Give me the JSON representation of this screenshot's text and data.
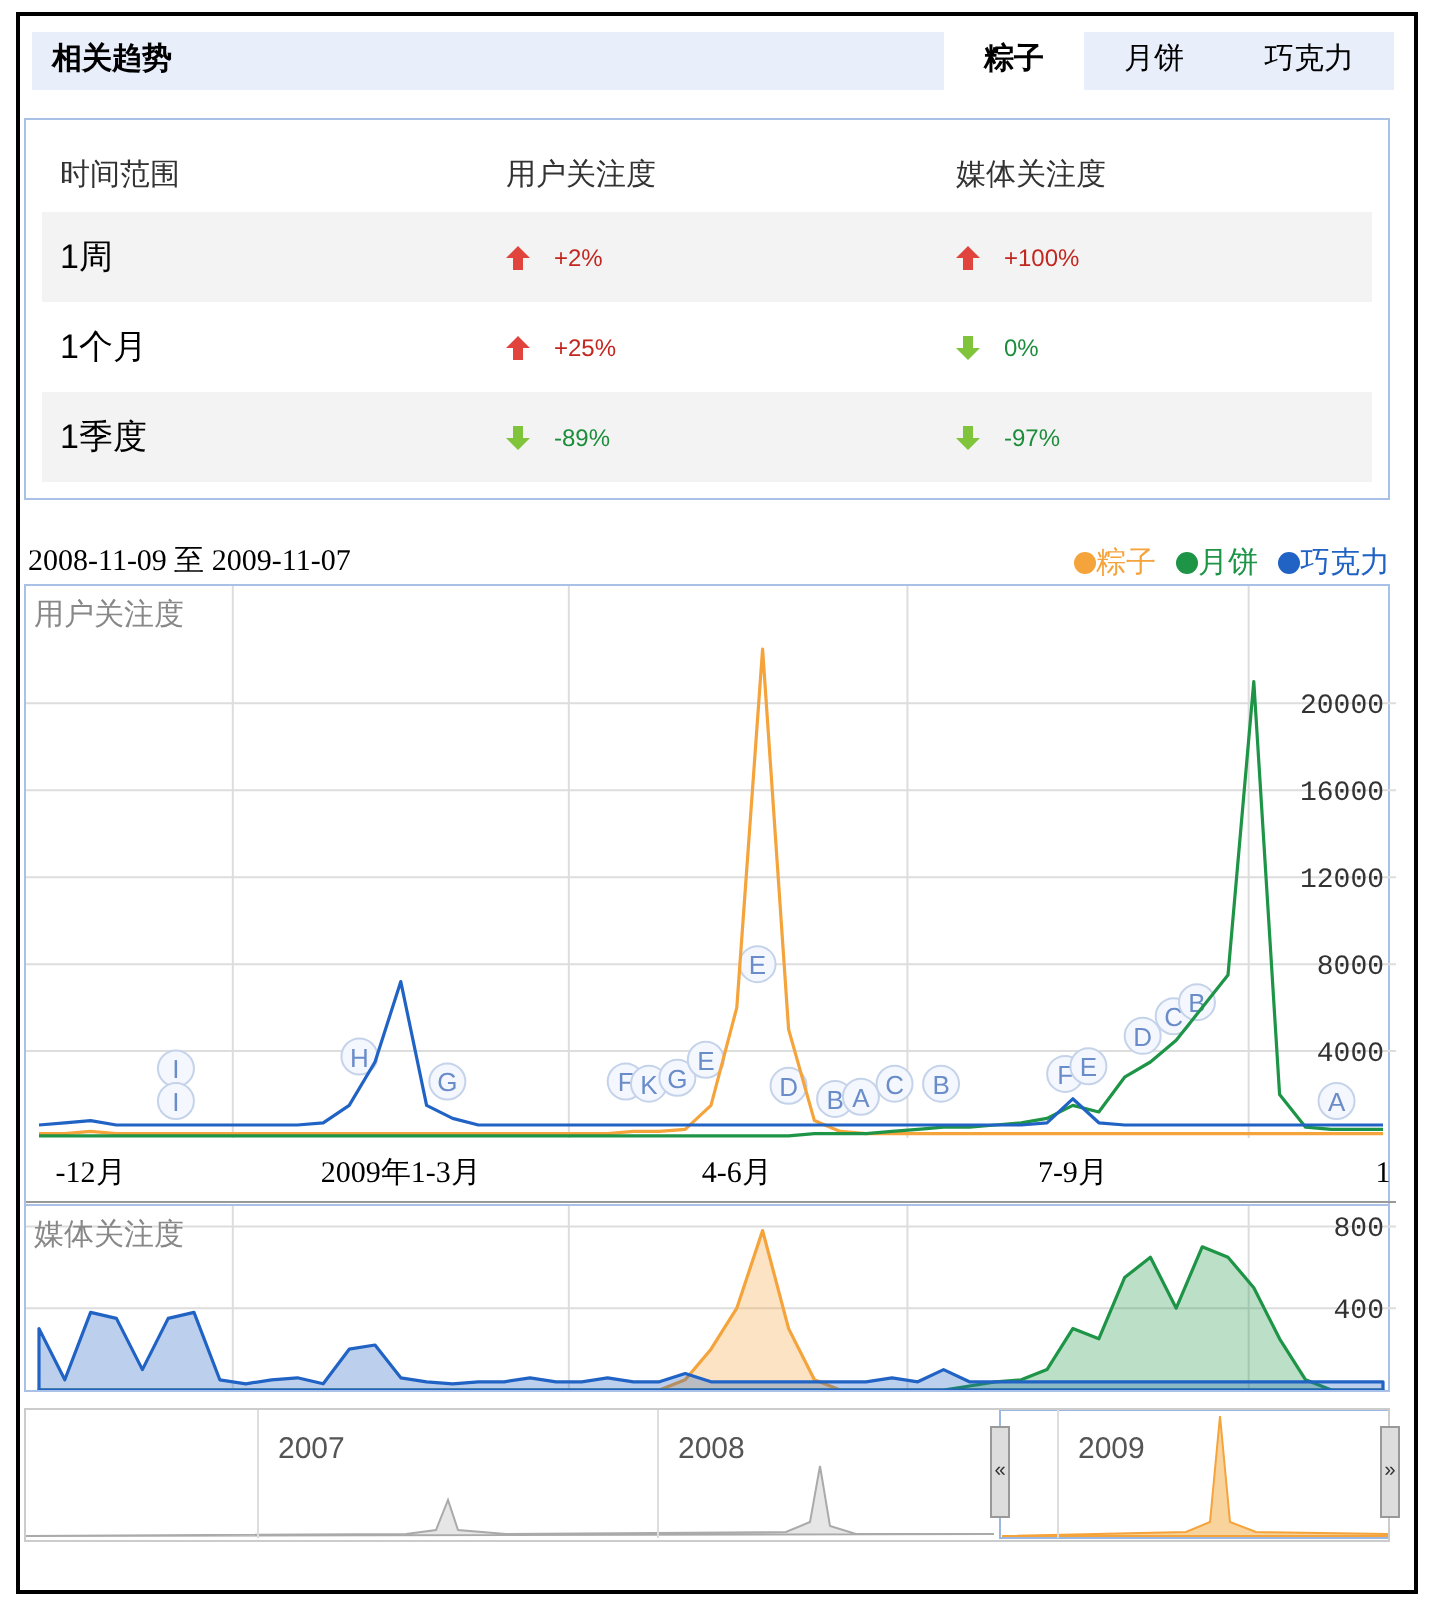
{
  "header": {
    "title": "相关趋势",
    "tabs": [
      {
        "label": "粽子",
        "selected": true
      },
      {
        "label": "月饼",
        "selected": false
      },
      {
        "label": "巧克力",
        "selected": false
      }
    ]
  },
  "summary": {
    "columns": [
      "时间范围",
      "用户关注度",
      "媒体关注度"
    ],
    "rows": [
      {
        "period": "1周",
        "user": {
          "value": "+2%",
          "rising": true
        },
        "media": {
          "value": "+100%",
          "rising": true
        }
      },
      {
        "period": "1个月",
        "user": {
          "value": "+25%",
          "rising": true
        },
        "media": {
          "value": "0%",
          "rising": false
        }
      },
      {
        "period": "1季度",
        "user": {
          "value": "-89%",
          "rising": false
        },
        "media": {
          "value": "-97%",
          "rising": false
        }
      }
    ]
  },
  "trends": {
    "date_range": "2008-11-09 至 2009-11-07",
    "user_chart": {
      "chart_data": {
        "type": "line",
        "title": "用户关注度",
        "grid": true,
        "categories": [
          null,
          null,
          "-12月",
          null,
          null,
          null,
          null,
          null,
          null,
          null,
          null,
          null,
          null,
          null,
          "2009年1-3月",
          null,
          null,
          null,
          null,
          null,
          null,
          null,
          null,
          null,
          null,
          null,
          null,
          "4-6月",
          null,
          null,
          null,
          null,
          null,
          null,
          null,
          null,
          null,
          null,
          null,
          null,
          "7-9月",
          null,
          null,
          null,
          null,
          null,
          null,
          null,
          null,
          null,
          null,
          null,
          "1"
        ],
        "ylim": [
          0,
          25400
        ],
        "yticks": [
          4000,
          8000,
          12000,
          16000,
          20000
        ],
        "series": [
          {
            "name": "粽子",
            "color": "#f5a33b",
            "values": [
              200,
              200,
              300,
              200,
              200,
              200,
              200,
              200,
              200,
              200,
              200,
              200,
              200,
              200,
              200,
              200,
              200,
              200,
              200,
              200,
              200,
              200,
              200,
              300,
              300,
              400,
              1500,
              6000,
              22500,
              5000,
              800,
              300,
              200,
              200,
              200,
              200,
              200,
              200,
              200,
              200,
              200,
              200,
              200,
              200,
              200,
              200,
              200,
              200,
              200,
              200,
              200,
              200,
              200
            ]
          },
          {
            "name": "月饼",
            "color": "#1e9447",
            "values": [
              100,
              100,
              100,
              100,
              100,
              100,
              100,
              100,
              100,
              100,
              100,
              100,
              100,
              100,
              100,
              100,
              100,
              100,
              100,
              100,
              100,
              100,
              100,
              100,
              100,
              100,
              100,
              100,
              100,
              100,
              200,
              200,
              200,
              300,
              400,
              500,
              500,
              600,
              700,
              900,
              1500,
              1200,
              2800,
              3500,
              4500,
              6000,
              7500,
              21000,
              2000,
              500,
              400,
              400,
              400
            ]
          },
          {
            "name": "巧克力",
            "color": "#2163c4",
            "values": [
              600,
              700,
              800,
              600,
              600,
              600,
              600,
              600,
              600,
              600,
              600,
              700,
              1500,
              3500,
              7200,
              1500,
              900,
              600,
              600,
              600,
              600,
              600,
              600,
              600,
              600,
              600,
              600,
              600,
              600,
              600,
              600,
              600,
              600,
              600,
              600,
              600,
              600,
              600,
              600,
              700,
              1800,
              700,
              600,
              600,
              600,
              600,
              600,
              600,
              600,
              600,
              600,
              600,
              600
            ]
          }
        ],
        "annotations": [
          "I",
          "I",
          "H",
          "G",
          "F",
          "K",
          "G",
          "E",
          "E",
          "D",
          "B",
          "A",
          "C",
          "B",
          "F",
          "E",
          "D",
          "C",
          "B",
          "A"
        ]
      }
    },
    "media_chart": {
      "chart_data": {
        "type": "area",
        "title": "媒体关注度",
        "categories": [
          null,
          null,
          null,
          null,
          null,
          null,
          null,
          null,
          null,
          null,
          null,
          null,
          null,
          null,
          null,
          null,
          null,
          null,
          null,
          null,
          null,
          null,
          null,
          null,
          null,
          null,
          null,
          null,
          null,
          null,
          null,
          null,
          null,
          null,
          null,
          null,
          null,
          null,
          null,
          null,
          null,
          null,
          null,
          null,
          null,
          null,
          null,
          null,
          null,
          null,
          null,
          null,
          null
        ],
        "ylim": [
          0,
          900
        ],
        "yticks": [
          400,
          800
        ],
        "grid": true,
        "series": [
          {
            "color": "#f5a33b",
            "values": [
              0,
              0,
              0,
              0,
              0,
              0,
              0,
              0,
              0,
              0,
              0,
              0,
              0,
              0,
              0,
              0,
              0,
              0,
              0,
              0,
              0,
              0,
              0,
              0,
              0,
              50,
              200,
              400,
              780,
              300,
              50,
              0,
              0,
              0,
              0,
              0,
              0,
              0,
              0,
              0,
              0,
              0,
              0,
              0,
              0,
              0,
              0,
              0,
              0,
              0,
              0,
              0,
              0
            ]
          },
          {
            "color": "#1e9447",
            "values": [
              0,
              0,
              0,
              0,
              0,
              0,
              0,
              0,
              0,
              0,
              0,
              0,
              0,
              0,
              0,
              0,
              0,
              0,
              0,
              0,
              0,
              0,
              0,
              0,
              0,
              0,
              0,
              0,
              0,
              0,
              0,
              0,
              0,
              0,
              0,
              0,
              20,
              40,
              50,
              100,
              300,
              250,
              550,
              650,
              400,
              700,
              650,
              500,
              250,
              50,
              0,
              0,
              0
            ]
          },
          {
            "color": "#2163c4",
            "values": [
              300,
              50,
              380,
              350,
              100,
              350,
              380,
              50,
              30,
              50,
              60,
              30,
              200,
              220,
              60,
              40,
              30,
              40,
              40,
              60,
              40,
              40,
              60,
              40,
              40,
              80,
              40,
              40,
              40,
              40,
              40,
              40,
              40,
              60,
              40,
              100,
              40,
              40,
              40,
              40,
              40,
              40,
              40,
              40,
              40,
              40,
              40,
              40,
              40,
              40,
              40,
              40,
              40
            ]
          }
        ]
      }
    }
  },
  "navigator": {
    "years": [
      "2007",
      "2008",
      "2009"
    ],
    "handles": [
      "«",
      "»"
    ]
  }
}
